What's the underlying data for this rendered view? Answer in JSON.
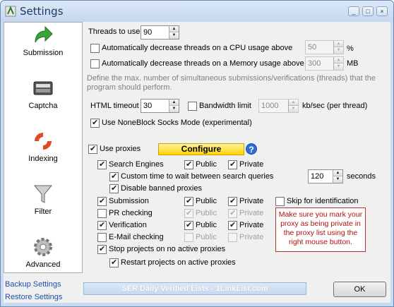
{
  "window": {
    "title": "Settings",
    "minimize": "_",
    "maximize": "□",
    "close": "×"
  },
  "sidebar": {
    "items": [
      {
        "label": "Submission",
        "icon": "green-arrow-icon",
        "selected": true
      },
      {
        "label": "Captcha",
        "icon": "keyboard-icon"
      },
      {
        "label": "Indexing",
        "icon": "lifebuoy-icon"
      },
      {
        "label": "Filter",
        "icon": "funnel-icon"
      },
      {
        "label": "Advanced",
        "icon": "gear-icon"
      }
    ],
    "backup_link": "Backup Settings",
    "restore_link": "Restore Settings"
  },
  "threads": {
    "label": "Threads to use",
    "value": "90",
    "cpu_label": "Automatically decrease threads on a CPU usage above",
    "cpu_value": "50",
    "cpu_unit": "%",
    "mem_label": "Automatically decrease threads on a Memory usage above",
    "mem_value": "300",
    "mem_unit": "MB",
    "hint_line1": "Define the max. number of simultaneous submissions/verifications (threads) that the",
    "hint_line2": "program should perform."
  },
  "html_timeout": {
    "label": "HTML timeout",
    "value": "30"
  },
  "bandwidth": {
    "label": "Bandwidth limit",
    "value": "1000",
    "unit": "kb/sec (per thread)"
  },
  "noneblock": {
    "label": "Use NoneBlock Socks Mode (experimental)",
    "checked": true
  },
  "proxies": {
    "use_label": "Use proxies",
    "configure_label": "Configure",
    "help": "?",
    "search_engines": "Search Engines",
    "public": "Public",
    "private": "Private",
    "custom_wait": "Custom time to wait between search queries",
    "custom_wait_value": "120",
    "seconds": "seconds",
    "disable_banned": "Disable banned proxies",
    "submission": "Submission",
    "skip_identification": "Skip for identification",
    "pr_checking": "PR checking",
    "verification": "Verification",
    "email_checking": "E-Mail checking",
    "stop_projects": "Stop projects on no active proxies",
    "restart_projects": "Restart projects on active proxies",
    "warning": "Make sure you mark your proxy as being private in the proxy list using the right mouse button."
  },
  "footer": {
    "banner": "SER Daily Verified Lists - 1LinkList.com",
    "ok": "OK"
  }
}
